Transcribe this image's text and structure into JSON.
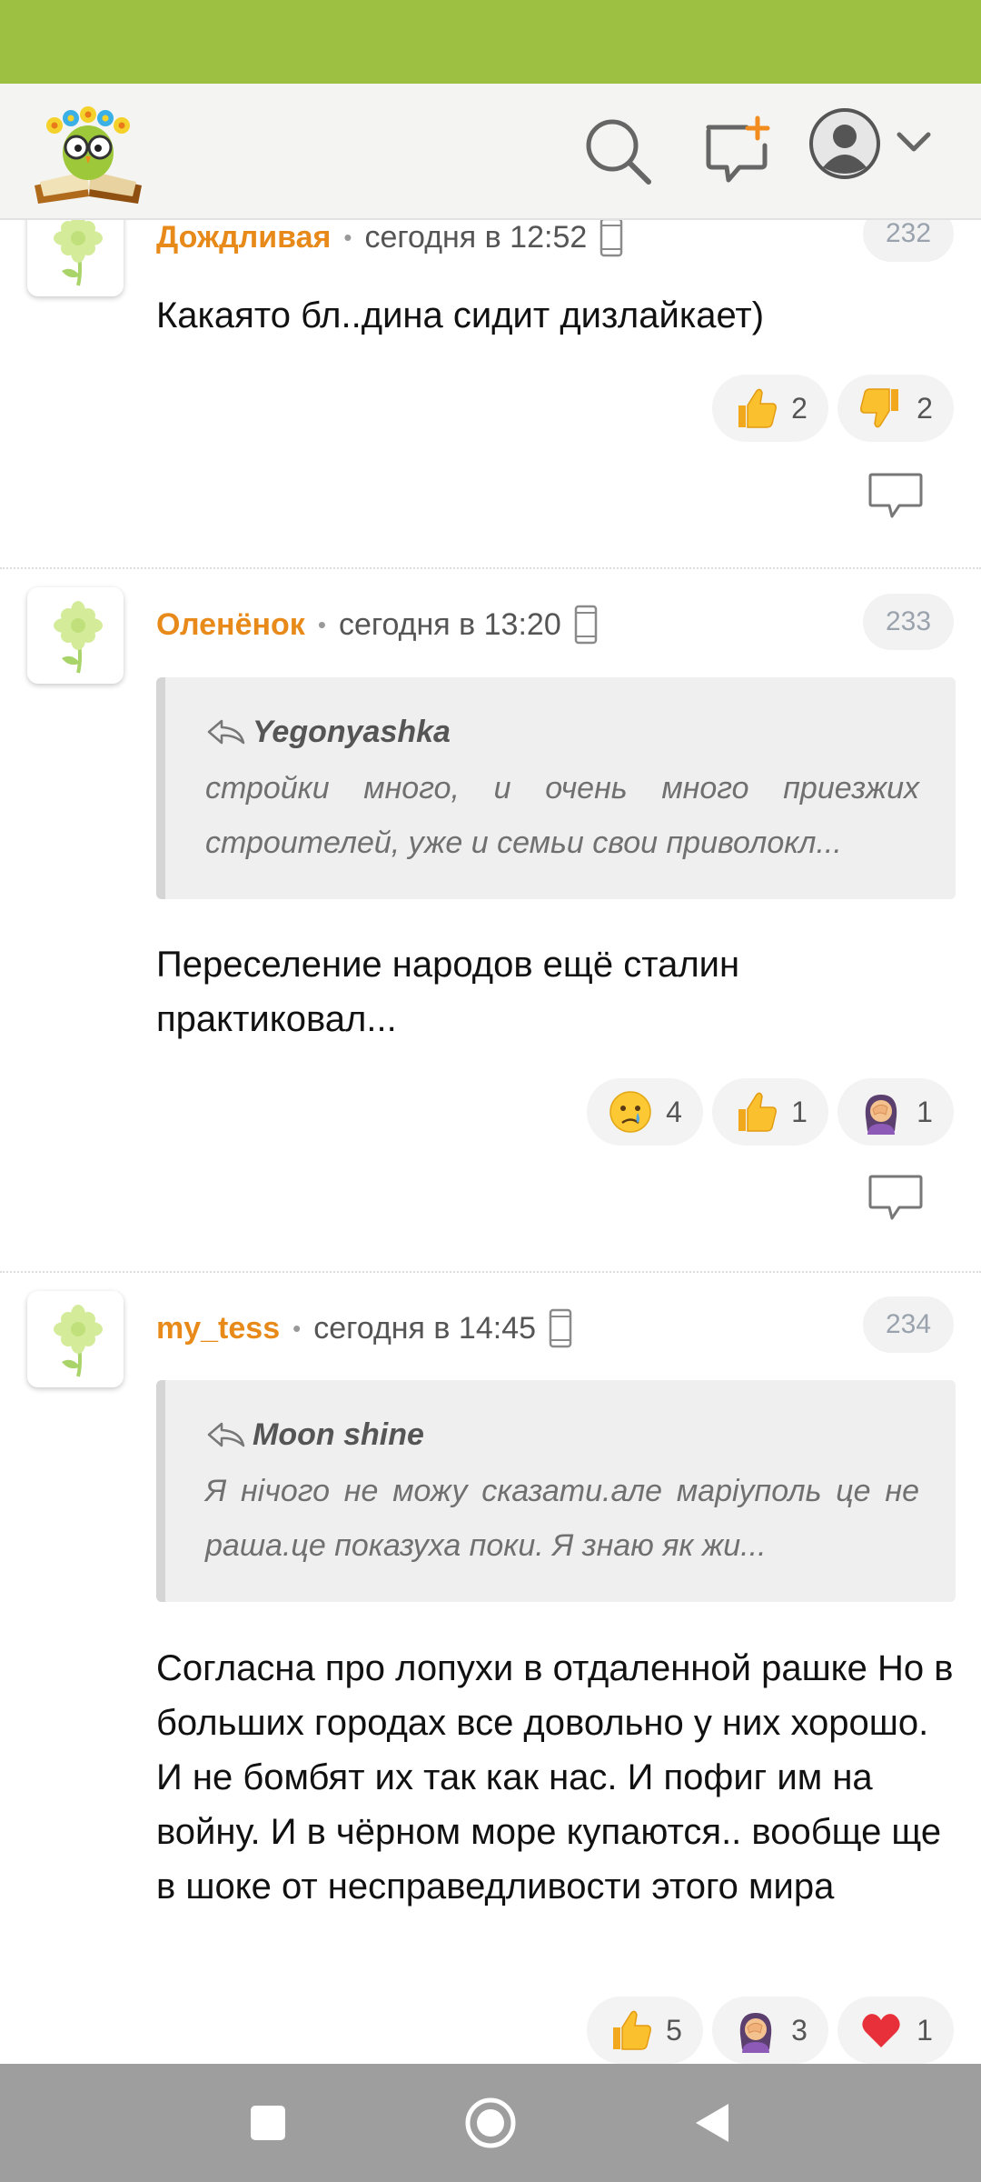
{
  "colors": {
    "accent": "#9dc043",
    "author": "#e88a1a"
  },
  "header": {
    "logo_icon": "owl-on-book-logo-icon",
    "search_icon": "search-icon",
    "new_post_icon": "new-post-icon",
    "profile_icon": "user-avatar-icon",
    "dropdown_icon": "chevron-down-icon"
  },
  "comments": [
    {
      "author": "Дождливая",
      "time": "сегодня в 12:52",
      "number": "232",
      "text": "Какаято бл..дина сидит дизлайкает)",
      "reactions": [
        {
          "emoji": "thumbs-up",
          "count": "2"
        },
        {
          "emoji": "thumbs-down",
          "count": "2"
        }
      ]
    },
    {
      "author": "Оленёнок",
      "time": "сегодня в 13:20",
      "number": "233",
      "quote": {
        "author": "Yegonyashka",
        "text": "стройки много, и очень много приезжих строителей, уже и семьи свои приволокл..."
      },
      "text": "Переселение народов ещё сталин практиковал...",
      "reactions": [
        {
          "emoji": "crying-face",
          "count": "4"
        },
        {
          "emoji": "thumbs-up",
          "count": "1"
        },
        {
          "emoji": "woman-facepalming",
          "count": "1"
        }
      ]
    },
    {
      "author": "my_tess",
      "time": "сегодня в 14:45",
      "number": "234",
      "quote": {
        "author": "Moon shine",
        "text": "Я нічого не можу сказати.але маріуполь це не раша.це показуха поки. Я знаю як жи..."
      },
      "text": "Согласна про лопухи в отдаленной рашке Но в больших городах все довольно у них хорошо. И не бомбят их так как нас. И пофиг им на войну. И в чёрном море купаются.. вообще ще в шоке от несправедливости этого мира",
      "reactions": [
        {
          "emoji": "thumbs-up",
          "count": "5"
        },
        {
          "emoji": "woman-facepalming",
          "count": "3"
        },
        {
          "emoji": "red-heart",
          "count": "1"
        }
      ]
    }
  ],
  "navbar": {
    "recents_icon": "square-icon",
    "home_icon": "circle-icon",
    "back_icon": "back-triangle-icon"
  }
}
